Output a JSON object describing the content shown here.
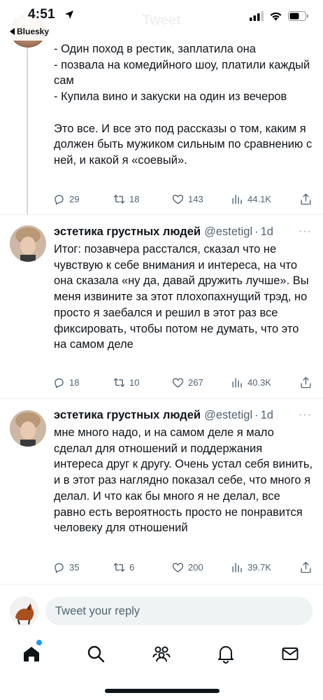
{
  "status_bar": {
    "time": "4:51",
    "back_app": "Bluesky",
    "ghost_title": "Tweet"
  },
  "tweets": [
    {
      "text": "- Один поход в рестик, заплатила она\n- позвала на комедийного шоу, платили каждый сам\n- Купила вино и закуски на один из вечеров\n\nЭто все. И все это под рассказы о том, каким я должен быть мужиком сильным по сравнению с ней, и какой я «соевый».",
      "replies": "29",
      "retweets": "18",
      "likes": "143",
      "views": "44.1K"
    },
    {
      "name": "эстетика грустных людей",
      "handle": "@estetigl",
      "dot": "·",
      "time": "1d",
      "text": "Итог: позавчера расстался, сказал что не чувствую к себе внимания и интереса, на что она сказала «ну да, давай дружить лучше». Вы меня извините за этот плохопахнущий трэд, но просто я заебался и решил в этот раз все фиксировать, чтобы потом не думать, что это на самом деле",
      "replies": "18",
      "retweets": "10",
      "likes": "267",
      "views": "40.3K"
    },
    {
      "name": "эстетика грустных людей",
      "handle": "@estetigl",
      "dot": "·",
      "time": "1d",
      "text": "мне много надо, и на самом деле я мало сделал для отношений и поддержания интереса друг к другу. Очень устал себя винить, и в этот раз наглядно показал себе, что много я делал. И что как бы много я не делал, все равно есть вероятность просто не понравится человеку для отношений",
      "replies": "35",
      "retweets": "6",
      "likes": "200",
      "views": "39.7K"
    }
  ],
  "reply_bar": {
    "placeholder": "Tweet your reply"
  },
  "more_glyph": "···",
  "colors": {
    "text": "#0f1419",
    "secondary": "#536471",
    "accent": "#1d9bf0",
    "divider": "#eff3f4"
  },
  "icons": [
    "location-arrow-icon",
    "signal-icon",
    "wifi-icon",
    "battery-icon",
    "reply-icon",
    "retweet-icon",
    "like-icon",
    "views-icon",
    "share-icon",
    "home-icon",
    "search-icon",
    "communities-icon",
    "notifications-icon",
    "messages-icon"
  ]
}
